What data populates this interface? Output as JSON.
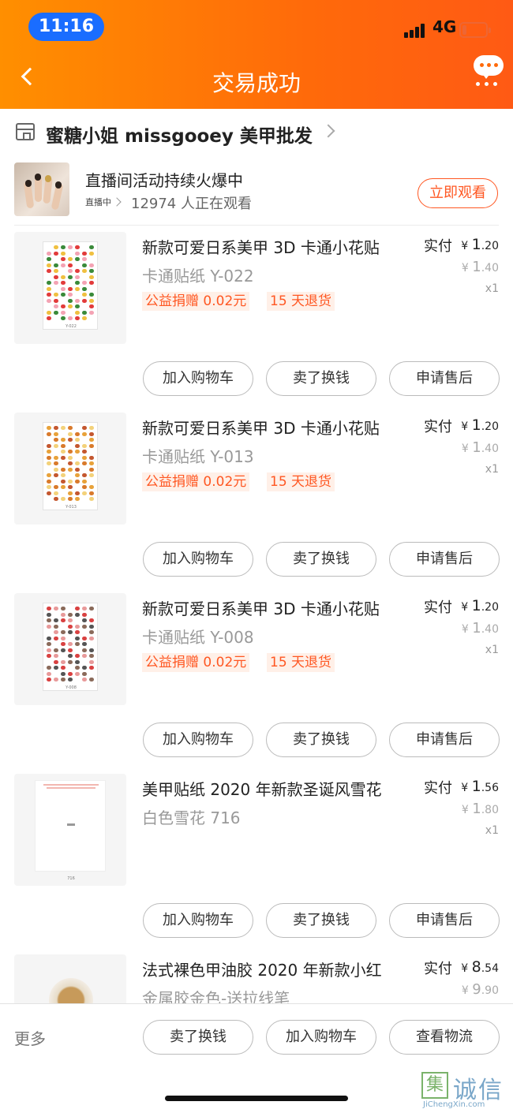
{
  "status_bar": {
    "time": "11:16",
    "network": "4G"
  },
  "header": {
    "title": "交易成功"
  },
  "shop": {
    "name": "蜜糖小姐 missgooey 美甲批发"
  },
  "live": {
    "title": "直播间活动持续火爆中",
    "tag": "直播中",
    "viewers": "12974 人正在观看",
    "watch_label": "立即观看"
  },
  "items": [
    {
      "name": "新款可爱日系美甲 3D 卡通小花贴",
      "spec": "卡通贴纸 Y-022",
      "tags": [
        "公益捐赠 0.02元",
        "15 天退货"
      ],
      "paid_label": "实付",
      "price_int": "1",
      "price_dec": ".20",
      "orig_int": "1",
      "orig_dec": ".40",
      "qty": "x1",
      "sheet_code": "Y-022",
      "actions": [
        "加入购物车",
        "卖了换钱",
        "申请售后"
      ]
    },
    {
      "name": "新款可爱日系美甲 3D 卡通小花贴",
      "spec": "卡通贴纸 Y-013",
      "tags": [
        "公益捐赠 0.02元",
        "15 天退货"
      ],
      "paid_label": "实付",
      "price_int": "1",
      "price_dec": ".20",
      "orig_int": "1",
      "orig_dec": ".40",
      "qty": "x1",
      "sheet_code": "Y-013",
      "actions": [
        "加入购物车",
        "卖了换钱",
        "申请售后"
      ]
    },
    {
      "name": "新款可爱日系美甲 3D 卡通小花贴",
      "spec": "卡通贴纸 Y-008",
      "tags": [
        "公益捐赠 0.02元",
        "15 天退货"
      ],
      "paid_label": "实付",
      "price_int": "1",
      "price_dec": ".20",
      "orig_int": "1",
      "orig_dec": ".40",
      "qty": "x1",
      "sheet_code": "Y-008",
      "actions": [
        "加入购物车",
        "卖了换钱",
        "申请售后"
      ]
    },
    {
      "name": "美甲贴纸 2020 年新款圣诞风雪花",
      "spec": "白色雪花 716",
      "tags": [],
      "paid_label": "实付",
      "price_int": "1",
      "price_dec": ".56",
      "orig_int": "1",
      "orig_dec": ".80",
      "qty": "x1",
      "sheet_code": "716",
      "actions": [
        "加入购物车",
        "卖了换钱",
        "申请售后"
      ]
    },
    {
      "name": "法式裸色甲油胶 2020 年新款小红",
      "spec": "金属胶金色-送拉线笔",
      "tags": [],
      "paid_label": "实付",
      "price_int": "8",
      "price_dec": ".54",
      "orig_int": "9",
      "orig_dec": ".90",
      "qty": "",
      "sheet_code": "",
      "actions": []
    }
  ],
  "bottom_bar": {
    "more_label": "更多",
    "buttons": [
      "卖了换钱",
      "加入购物车",
      "查看物流"
    ]
  },
  "watermark": {
    "char": "集",
    "name": "诚信",
    "url": "JiChengXin.com"
  },
  "colors": {
    "header_start": "#ff8f00",
    "header_end": "#ff5a14",
    "accent": "#ff5722",
    "tag_bg": "#fff0e8"
  },
  "icons": [
    "back-icon",
    "chat-icon",
    "shop-icon",
    "chevron-right-icon"
  ]
}
